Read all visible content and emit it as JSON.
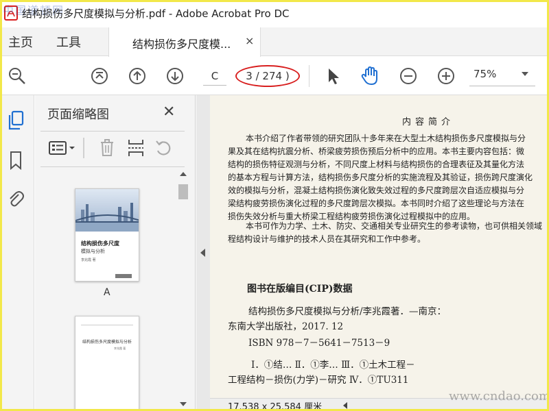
{
  "window": {
    "title": "结构损伤多尺度模拟与分析.pdf - Adobe Acrobat Pro DC",
    "watermark_top": "中国道顿网"
  },
  "tabs": {
    "home": "主页",
    "tools": "工具",
    "document": "结构损伤多尺度模...",
    "close_glyph": "×"
  },
  "toolbar": {
    "page_input": "C",
    "page_count": "3 / 274 )",
    "zoom": "75%",
    "accent_color": "#1f6fd1",
    "highlight_color": "#d81e1e"
  },
  "panel": {
    "title": "页面缩略图",
    "close_glyph": "✕",
    "thumbnails": [
      {
        "label": "A",
        "cover_title": "结构损伤多尺度",
        "cover_subtitle": "模拟与分析",
        "cover_author": "李兆霞 著"
      },
      {
        "label": "",
        "page_title": "结构损伤多尺度模拟与分析",
        "page_author": "李兆霞 著"
      }
    ]
  },
  "document": {
    "heading": "内容简介",
    "paragraphs": [
      "本书介绍了作者带领的研究团队十多年来在大型土木结构损伤多尺度模拟与分",
      "果及其在结构抗震分析、桥梁疲劳损伤预后分析中的应用。本书主要内容包括：微",
      "结构的损伤特征观测与分析，不同尺度上材料与结构损伤的合理表征及其量化方法",
      "的基本方程与计算方法，结构损伤多尺度分析的实施流程及其验证，损伤跨尺度演化",
      "效的模拟与分析，混凝土结构损伤演化致失效过程的多尺度跨层次自适应模拟与分",
      "梁结构疲劳损伤演化过程的多尺度跨层次模拟。本书同时介绍了这些理论与方法在",
      "损伤失效分析与重大桥梁工程结构疲劳损伤演化过程模拟中的应用。",
      "本书可作为力学、土木、防灾、交通相关专业研究生的参考读物，也可供相关领域",
      "程结构设计与维护的技术人员在其研究和工作中参考。"
    ],
    "cip_heading": "图书在版编目(CIP)数据",
    "cip_lines": [
      "结构损伤多尺度模拟与分析/李兆霞著．—南京：",
      "东南大学出版社，2017. 12",
      "ISBN 978－7－5641－7513－9",
      "Ⅰ．①结…   Ⅱ．①李…   Ⅲ．①土木工程－",
      "工程结构－损伤(力学)－研究   Ⅳ．①TU311"
    ],
    "page_size": "17.538 x 25.584 厘米",
    "watermark": "www.cndao.com"
  }
}
